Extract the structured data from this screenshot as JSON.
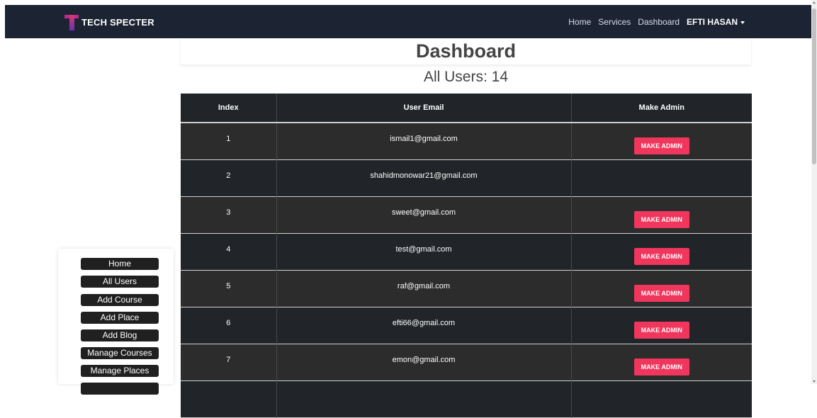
{
  "navbar": {
    "brand": "TECH SPECTER",
    "links": [
      "Home",
      "Services",
      "Dashboard"
    ],
    "user": "EFTI HASAN"
  },
  "main": {
    "title": "Dashboard",
    "all_users": "All Users: 14"
  },
  "table": {
    "headers": [
      "Index",
      "User Email",
      "Make Admin"
    ],
    "rows": [
      {
        "index": "1",
        "email": "ismail1@gmail.com",
        "action": "MAKE ADMIN"
      },
      {
        "index": "2",
        "email": "shahidmonowar21@gmail.com",
        "action": ""
      },
      {
        "index": "3",
        "email": "sweet@gmail.com",
        "action": "MAKE ADMIN"
      },
      {
        "index": "4",
        "email": "test@gmail.com",
        "action": "MAKE ADMIN"
      },
      {
        "index": "5",
        "email": "raf@gmail.com",
        "action": "MAKE ADMIN"
      },
      {
        "index": "6",
        "email": "efti66@gmail.com",
        "action": "MAKE ADMIN"
      },
      {
        "index": "7",
        "email": "emon@gmail.com",
        "action": "MAKE ADMIN"
      }
    ]
  },
  "sidebar": {
    "items": [
      "Home",
      "All Users",
      "Add Course",
      "Add Place",
      "Add Blog",
      "Manage Courses",
      "Manage Places"
    ]
  },
  "colors": {
    "navbar_bg": "#1c2433",
    "make_admin_button": "#f0365c",
    "table_dark": "#212529"
  }
}
